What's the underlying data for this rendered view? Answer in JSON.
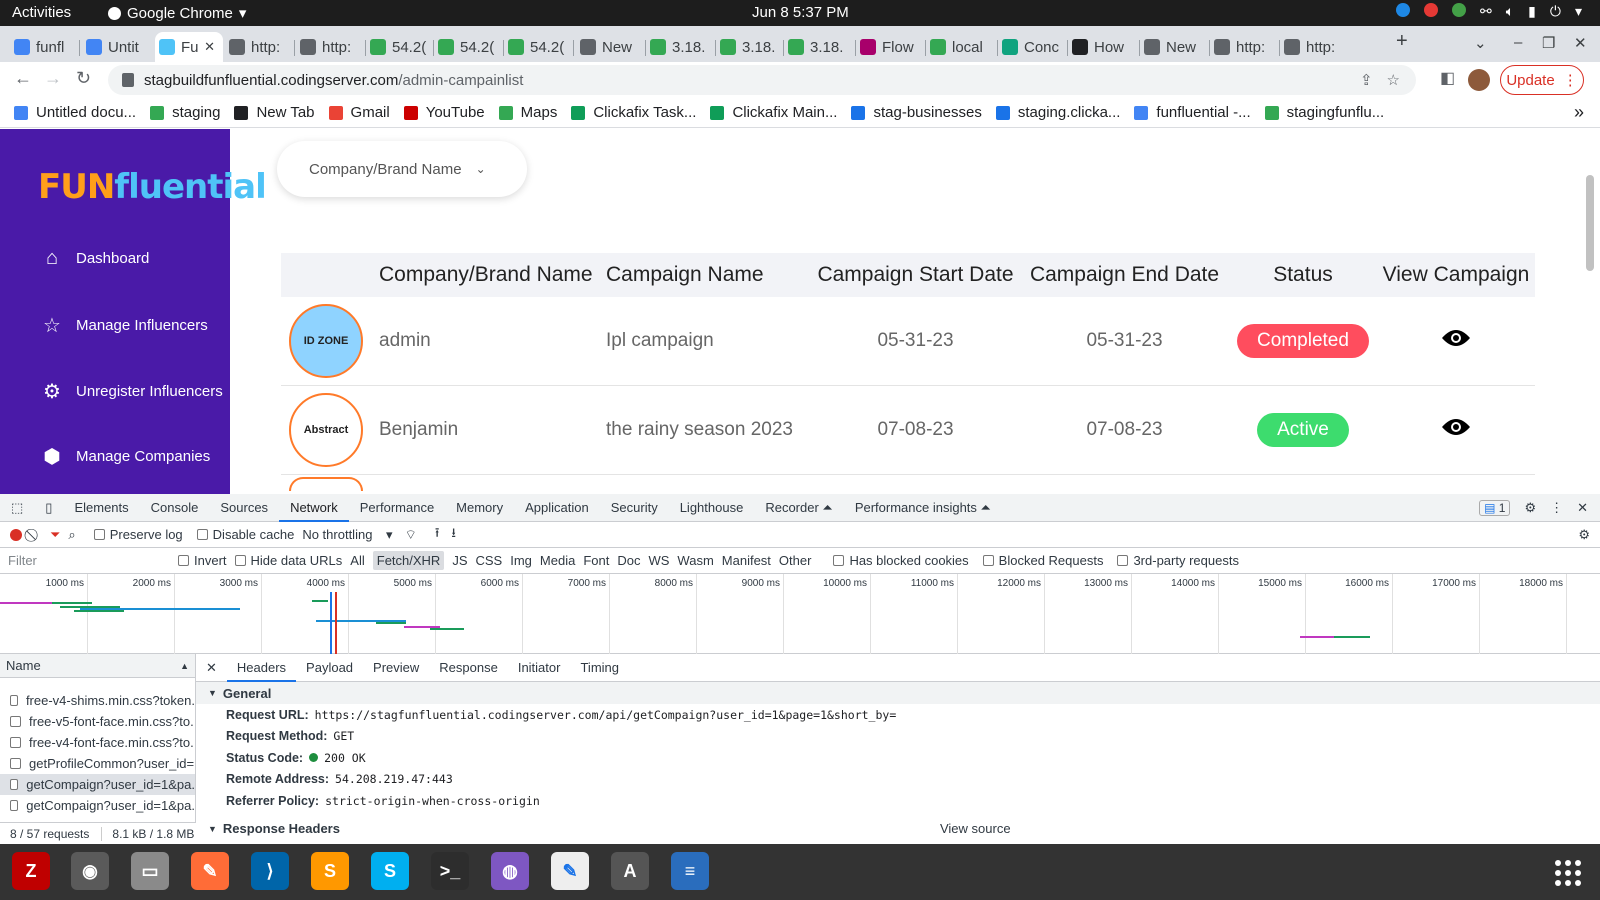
{
  "topbar": {
    "activities": "Activities",
    "app_name": "Google Chrome",
    "datetime": "Jun 8  5:37 PM"
  },
  "tabs": [
    {
      "label": "funfl",
      "fav": "#4285f4"
    },
    {
      "label": "Untit",
      "fav": "#4285f4"
    },
    {
      "label": "Fu",
      "fav": "#4fc3f7"
    },
    {
      "label": "http:",
      "fav": "#5f6368"
    },
    {
      "label": "http:",
      "fav": "#5f6368"
    },
    {
      "label": "54.2(",
      "fav": "#34a853"
    },
    {
      "label": "54.2(",
      "fav": "#34a853"
    },
    {
      "label": "54.2(",
      "fav": "#34a853"
    },
    {
      "label": "New",
      "fav": "#5f6368"
    },
    {
      "label": "3.18.",
      "fav": "#34a853"
    },
    {
      "label": "3.18.",
      "fav": "#34a853"
    },
    {
      "label": "3.18.",
      "fav": "#34a853"
    },
    {
      "label": "Flow",
      "fav": "#a8006b"
    },
    {
      "label": "local",
      "fav": "#34a853"
    },
    {
      "label": "Conc",
      "fav": "#10a37f"
    },
    {
      "label": "How",
      "fav": "#202124"
    },
    {
      "label": "New",
      "fav": "#5f6368"
    },
    {
      "label": "http:",
      "fav": "#5f6368"
    },
    {
      "label": "http:",
      "fav": "#5f6368"
    }
  ],
  "tab_new_label": "+",
  "address": {
    "host": "stagbuildfunfluential.codingserver.com",
    "path": "/admin-campainlist"
  },
  "update_label": "Update",
  "bookmarks": [
    {
      "label": "Untitled docu...",
      "color": "#4285f4"
    },
    {
      "label": "staging",
      "color": "#34a853"
    },
    {
      "label": "New Tab",
      "color": "#202124"
    },
    {
      "label": "Gmail",
      "color": "#ea4335"
    },
    {
      "label": "YouTube",
      "color": "#c00"
    },
    {
      "label": "Maps",
      "color": "#34a853"
    },
    {
      "label": "Clickafix Task...",
      "color": "#0f9d58"
    },
    {
      "label": "Clickafix Main...",
      "color": "#0f9d58"
    },
    {
      "label": "stag-businesses",
      "color": "#1a73e8"
    },
    {
      "label": "staging.clicka...",
      "color": "#1a73e8"
    },
    {
      "label": "funfluential -...",
      "color": "#4285f4"
    },
    {
      "label": "stagingfunflu...",
      "color": "#34a853"
    }
  ],
  "bookmarks_more": "»",
  "sidebar": {
    "logo_fun": "FUN",
    "logo_fluential": "fluential",
    "items": [
      "Dashboard",
      "Manage Influencers",
      "Unregister Influencers",
      "Manage Companies"
    ]
  },
  "filter_select": "Company/Brand Name",
  "table": {
    "headers": [
      "Company/Brand Name",
      "Campaign Name",
      "Campaign Start Date",
      "Campaign End Date",
      "Status",
      "View Campaign"
    ],
    "rows": [
      {
        "company": "admin",
        "campaign": "Ipl campaign",
        "start": "05-31-23",
        "end": "05-31-23",
        "status": "Completed",
        "status_color": "#ff4d5e",
        "avatar_text": "ID ZONE",
        "avatar_bg": "#8fd3ff"
      },
      {
        "company": "Benjamin",
        "campaign": "the rainy season 2023",
        "start": "07-08-23",
        "end": "07-08-23",
        "status": "Active",
        "status_color": "#3ddc6e",
        "avatar_text": "Abstract",
        "avatar_bg": "#ffffff"
      }
    ]
  },
  "devtools": {
    "tabs": [
      "Elements",
      "Console",
      "Sources",
      "Network",
      "Performance",
      "Memory",
      "Application",
      "Security",
      "Lighthouse",
      "Recorder ⏶",
      "Performance insights ⏶"
    ],
    "issues_count": "1",
    "toolbar": {
      "preserve_log": "Preserve log",
      "disable_cache": "Disable cache",
      "throttling": "No throttling"
    },
    "filter_placeholder": "Filter",
    "filter_types": [
      "Invert",
      "Hide data URLs",
      "All",
      "Fetch/XHR",
      "JS",
      "CSS",
      "Img",
      "Media",
      "Font",
      "Doc",
      "WS",
      "Wasm",
      "Manifest",
      "Other"
    ],
    "filter_checks": [
      "Has blocked cookies",
      "Blocked Requests",
      "3rd-party requests"
    ],
    "timeline_ticks": [
      "1000 ms",
      "2000 ms",
      "3000 ms",
      "4000 ms",
      "5000 ms",
      "6000 ms",
      "7000 ms",
      "8000 ms",
      "9000 ms",
      "10000 ms",
      "11000 ms",
      "12000 ms",
      "13000 ms",
      "14000 ms",
      "15000 ms",
      "16000 ms",
      "17000 ms",
      "18000 ms"
    ],
    "name_header": "Name",
    "requests": [
      "free-v4-shims.min.css?token.",
      "free-v5-font-face.min.css?to.",
      "free-v4-font-face.min.css?to.",
      "getProfileCommon?user_id=",
      "getCompaign?user_id=1&pa.",
      "getCompaign?user_id=1&pa."
    ],
    "summary": "8 / 57 requests",
    "transfer": "8.1 kB / 1.8 MB",
    "detail_tabs": [
      "Headers",
      "Payload",
      "Preview",
      "Response",
      "Initiator",
      "Timing"
    ],
    "general_label": "General",
    "general": [
      {
        "k": "Request URL:",
        "v": "https://stagfunfluential.codingserver.com/api/getCompaign?user_id=1&page=1&short_by="
      },
      {
        "k": "Request Method:",
        "v": "GET"
      },
      {
        "k": "Status Code:",
        "v": "200 OK"
      },
      {
        "k": "Remote Address:",
        "v": "54.208.219.47:443"
      },
      {
        "k": "Referrer Policy:",
        "v": "strict-origin-when-cross-origin"
      }
    ],
    "response_headers_label": "Response Headers",
    "view_source": "View source"
  },
  "dock": [
    {
      "name": "filezilla-icon",
      "glyph": "Z",
      "bg": "#bf0000"
    },
    {
      "name": "chrome-icon",
      "glyph": "◉",
      "bg": "#5a5a5a"
    },
    {
      "name": "files-icon",
      "glyph": "▭",
      "bg": "#8a8a8a"
    },
    {
      "name": "postman-icon",
      "glyph": "✎",
      "bg": "#ff6c37"
    },
    {
      "name": "vscode-icon",
      "glyph": "⟩",
      "bg": "#0065a9"
    },
    {
      "name": "sublime-icon",
      "glyph": "S",
      "bg": "#ff9800"
    },
    {
      "name": "skype-icon",
      "glyph": "S",
      "bg": "#00aff0"
    },
    {
      "name": "terminal-icon",
      "glyph": ">_",
      "bg": "#2d2d2d"
    },
    {
      "name": "vpn-globe-icon",
      "glyph": "◍",
      "bg": "#7e57c2"
    },
    {
      "name": "text-editor-icon",
      "glyph": "✎",
      "bg": "#eeeeee"
    },
    {
      "name": "updates-icon",
      "glyph": "A",
      "bg": "#555555"
    },
    {
      "name": "libreoffice-writer-icon",
      "glyph": "≡",
      "bg": "#2a6dbd"
    }
  ]
}
